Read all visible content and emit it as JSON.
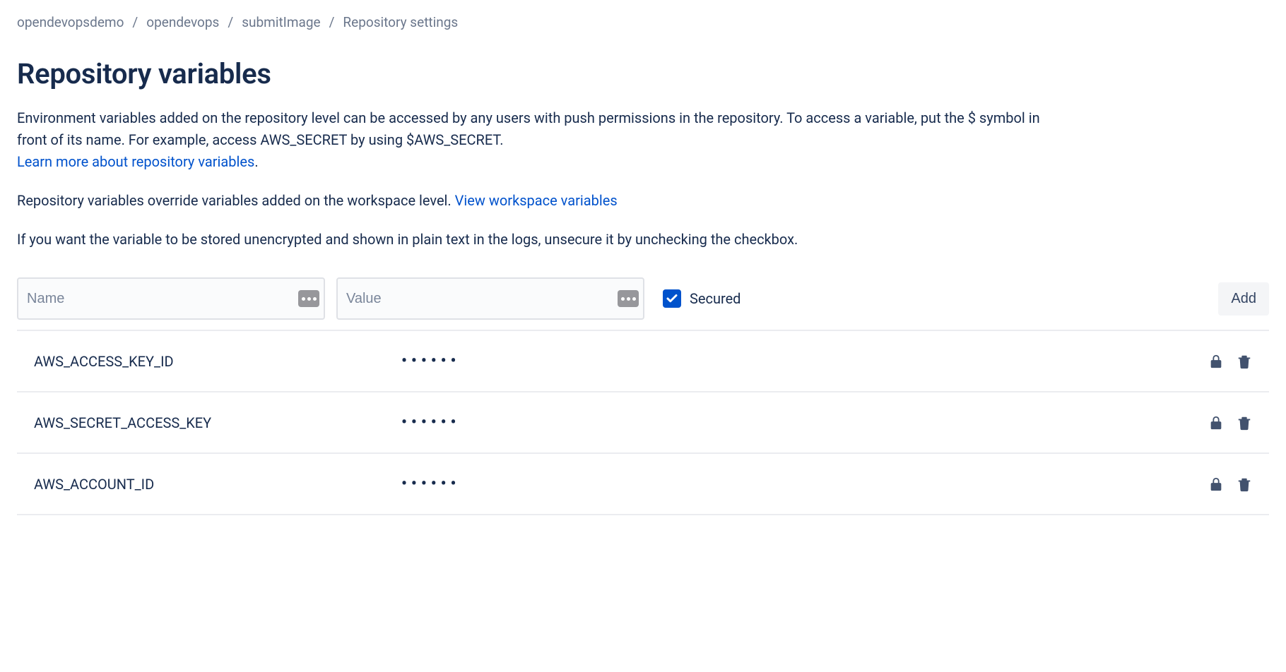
{
  "breadcrumb": {
    "items": [
      {
        "label": "opendevopsdemo"
      },
      {
        "label": "opendevops"
      },
      {
        "label": "submitImage"
      },
      {
        "label": "Repository settings"
      }
    ],
    "separator": "/"
  },
  "page": {
    "title": "Repository variables",
    "desc_intro": "Environment variables added on the repository level can be accessed by any users with push permissions in the repository. To access a variable, put the $ symbol in front of its name. For example, access AWS_SECRET by using $AWS_SECRET.",
    "learn_more_link": "Learn more about repository variables",
    "override_text_prefix": "Repository variables override variables added on the workspace level. ",
    "view_workspace_link": "View workspace variables",
    "unsecure_text": "If you want the variable to be stored unencrypted and shown in plain text in the logs, unsecure it by unchecking the checkbox."
  },
  "form": {
    "name_placeholder": "Name",
    "value_placeholder": "Value",
    "secured_label": "Secured",
    "add_button": "Add"
  },
  "variables": [
    {
      "name": "AWS_ACCESS_KEY_ID",
      "value_masked": "••••••"
    },
    {
      "name": "AWS_SECRET_ACCESS_KEY",
      "value_masked": "••••••"
    },
    {
      "name": "AWS_ACCOUNT_ID",
      "value_masked": "••••••"
    }
  ]
}
